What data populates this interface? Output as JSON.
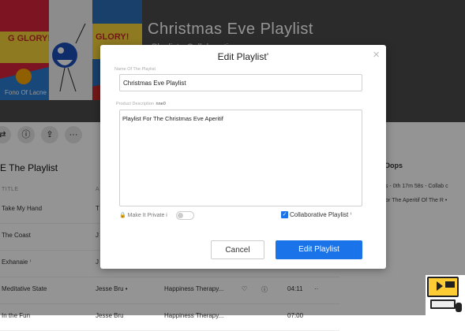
{
  "playlist": {
    "title": "Christmas Eve Playlist",
    "subtitle": "Playlist · Collaborative",
    "cover_captions": [
      "Fono Of Lacne"
    ]
  },
  "list": {
    "title": "E The Playlist",
    "column_title": "TITLE",
    "column_artist": "A",
    "rows": [
      {
        "title": "Take My Hand",
        "artist": "T",
        "album": "",
        "duration": ""
      },
      {
        "title": "The Coast",
        "artist": "J",
        "album": "",
        "duration": ""
      },
      {
        "title": "Exhanaie ⁱ",
        "artist": "J",
        "album": "",
        "duration": ""
      },
      {
        "title": "Meditative State",
        "artist": "Jesse Bru •",
        "album": "Happiness Therapy...",
        "duration": "04:11"
      },
      {
        "title": "In the Fun",
        "artist": "Jesse Bru",
        "album": "Happiness Therapy...",
        "duration": "07:00"
      }
    ]
  },
  "right_panel": {
    "title": "Oops",
    "line1": "es - 0th 17m 58s - Collab c",
    "line2": "For The Aperitif Of The R •"
  },
  "modal": {
    "title": "Edit Playlist’",
    "close": "×",
    "name_label": "Name Of The Playlist",
    "name_value": "Christmas Eve Playlist",
    "desc_label": "Product Description",
    "desc_hint": "nne0",
    "desc_value": "Playlist For The Christmas Eve Aperitif",
    "private_label": "Make It Private i",
    "private_on": false,
    "collab_label": "Collaborative Playlist ⁱ",
    "collab_checked": true,
    "cancel_label": "Cancel",
    "save_label": "Edit Playlist"
  },
  "icons": {
    "toolbar": [
      "shuffle-icon",
      "info-icon",
      "share-icon",
      "more-icon"
    ]
  },
  "colors": {
    "accent": "#1a73e8",
    "hero_bg": "#4a4a4a"
  }
}
